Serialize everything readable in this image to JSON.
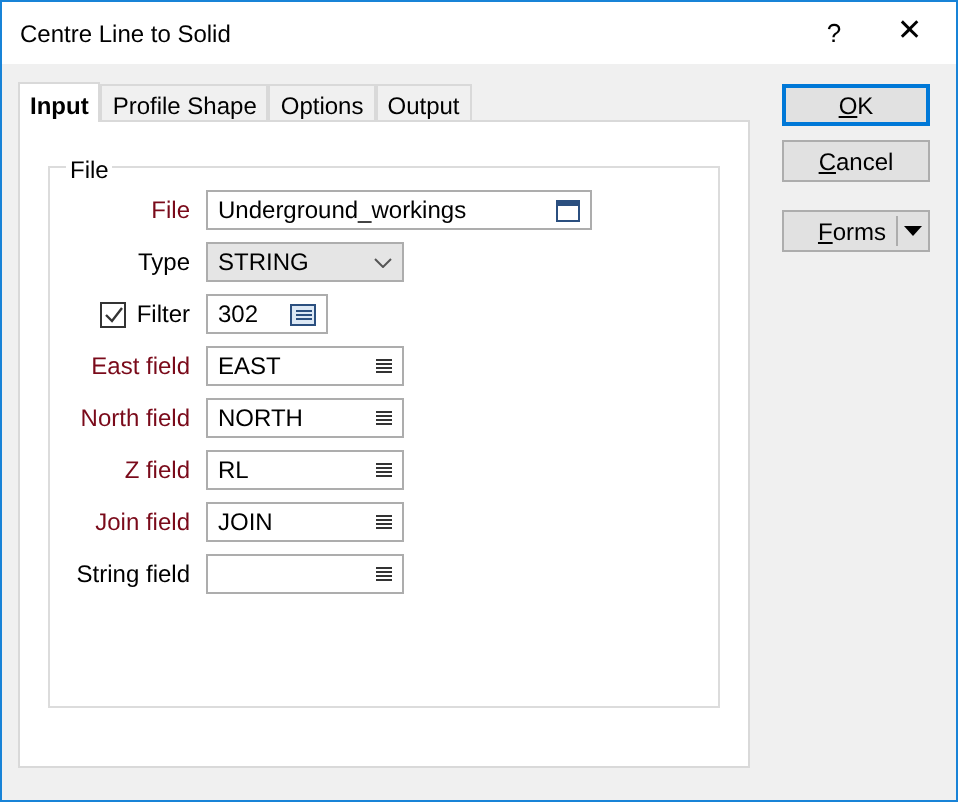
{
  "window": {
    "title": "Centre Line to Solid",
    "help": "?",
    "close": "✕"
  },
  "tabs": [
    {
      "label": "Input",
      "selected": true
    },
    {
      "label": "Profile Shape",
      "selected": false
    },
    {
      "label": "Options",
      "selected": false
    },
    {
      "label": "Output",
      "selected": false
    }
  ],
  "group": {
    "title": "File"
  },
  "fields": [
    {
      "kind": "file",
      "label": "File",
      "required": true,
      "value": "Underground_workings"
    },
    {
      "kind": "combo",
      "label": "Type",
      "required": false,
      "value": "STRING"
    },
    {
      "kind": "filter",
      "label": "Filter",
      "checked": true,
      "value": "302"
    },
    {
      "kind": "list",
      "label": "East field",
      "required": true,
      "value": "EAST"
    },
    {
      "kind": "list",
      "label": "North field",
      "required": true,
      "value": "NORTH"
    },
    {
      "kind": "list",
      "label": "Z field",
      "required": true,
      "value": "RL"
    },
    {
      "kind": "list",
      "label": "Join field",
      "required": true,
      "value": "JOIN"
    },
    {
      "kind": "list",
      "label": "String field",
      "required": false
    }
  ],
  "buttons": [
    {
      "label": "OK",
      "default": true
    },
    {
      "label": "Cancel",
      "default": false
    }
  ],
  "forms_button": {
    "label": "Forms"
  }
}
